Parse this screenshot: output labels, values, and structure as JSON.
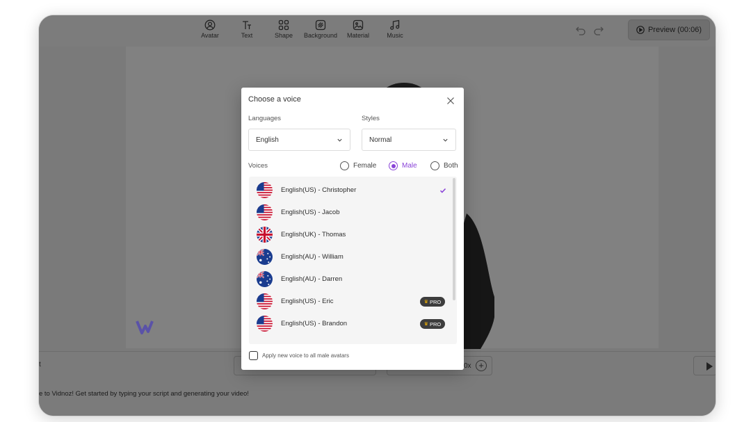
{
  "toolbar": {
    "tools": [
      {
        "label": "Avatar",
        "icon": "avatar-icon"
      },
      {
        "label": "Text",
        "icon": "text-icon"
      },
      {
        "label": "Shape",
        "icon": "shape-icon"
      },
      {
        "label": "Background",
        "icon": "background-icon"
      },
      {
        "label": "Material",
        "icon": "material-icon"
      },
      {
        "label": "Music",
        "icon": "music-icon"
      }
    ],
    "preview_label": "Preview (00:06)"
  },
  "bottom": {
    "left_label": "t",
    "speed_value": "0x",
    "plus": "+"
  },
  "script": {
    "text": "e to Vidnoz! Get started by typing your script and generating your video!"
  },
  "modal": {
    "title": "Choose a voice",
    "languages_label": "Languages",
    "language_value": "English",
    "styles_label": "Styles",
    "style_value": "Normal",
    "voices_label": "Voices",
    "gender": {
      "female": "Female",
      "male": "Male",
      "both": "Both",
      "selected": "Male"
    },
    "voices": [
      {
        "name": "English(US) - Christopher",
        "flag": "us",
        "selected": true,
        "pro": false
      },
      {
        "name": "English(US) - Jacob",
        "flag": "us",
        "selected": false,
        "pro": false
      },
      {
        "name": "English(UK) - Thomas",
        "flag": "uk",
        "selected": false,
        "pro": false
      },
      {
        "name": "English(AU) - William",
        "flag": "au",
        "selected": false,
        "pro": false
      },
      {
        "name": "English(AU) - Darren",
        "flag": "au",
        "selected": false,
        "pro": false
      },
      {
        "name": "English(US) - Eric",
        "flag": "us",
        "selected": false,
        "pro": true
      },
      {
        "name": "English(US) - Brandon",
        "flag": "us",
        "selected": false,
        "pro": true
      }
    ],
    "pro_label": "PRO",
    "apply_label": "Apply new voice to all male avatars"
  },
  "colors": {
    "accent": "#8a44d8",
    "overlay": "#7a7a7a"
  }
}
